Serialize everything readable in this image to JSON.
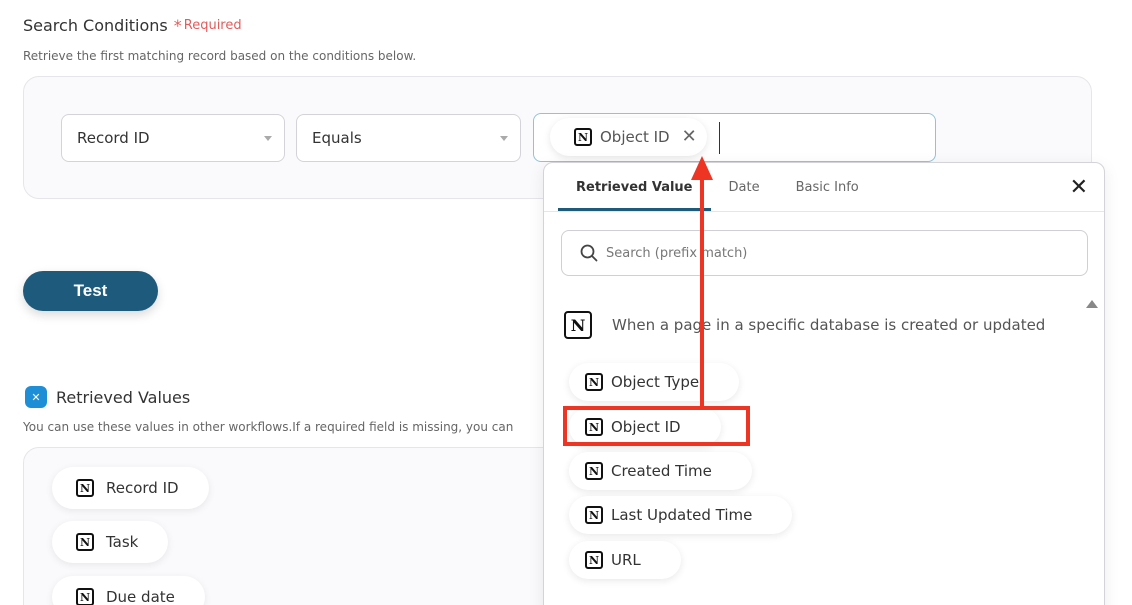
{
  "search_conditions": {
    "title": "Search Conditions",
    "required_mark": "*",
    "required_text": "Required",
    "description": "Retrieve the first matching record based on the conditions below.",
    "field_select": "Record ID",
    "operator_select": "Equals",
    "value_chip": "Object ID",
    "value_chip_icon": "notion-icon",
    "value_chip_remove": "✕"
  },
  "test_button": "Test",
  "retrieved_values": {
    "title": "Retrieved Values",
    "description": "You can use these values in other workflows.If a required field is missing, you can",
    "items": [
      "Record ID",
      "Task",
      "Due date"
    ]
  },
  "picker": {
    "tabs": [
      "Retrieved Value",
      "Date",
      "Basic Info"
    ],
    "active_tab": "Retrieved Value",
    "close": "✕",
    "search_placeholder": "Search (prefix match)",
    "trigger_label": "When a page in a specific database is created or updated",
    "options": [
      "Object Type",
      "Object ID",
      "Created Time",
      "Last Updated Time",
      "URL"
    ],
    "highlighted_option": "Object ID"
  },
  "annotation": {
    "color": "#ee3524"
  },
  "colors": {
    "primary": "#1e5a7b",
    "required": "#e25c5c",
    "focus_border": "#8fc4d8"
  }
}
